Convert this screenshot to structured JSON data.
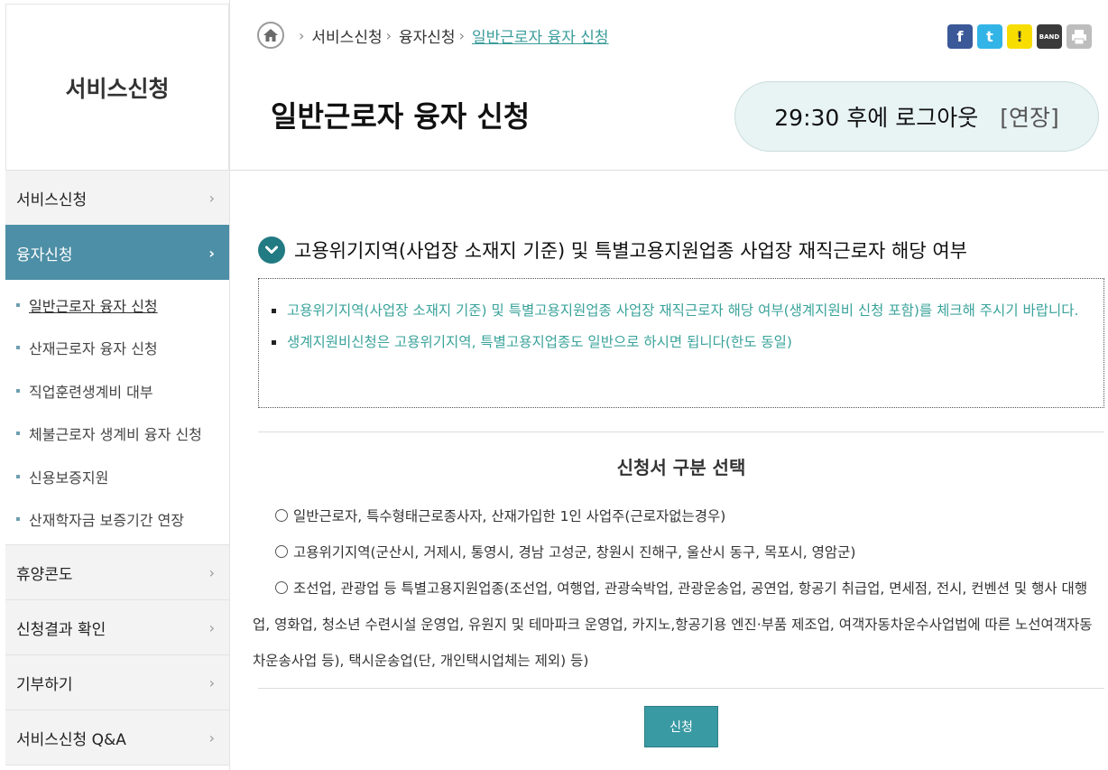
{
  "sidebar": {
    "title": "서비스신청",
    "items": [
      {
        "label": "서비스신청",
        "chevron": "›"
      },
      {
        "label": "융자신청",
        "chevron": "›"
      },
      {
        "label": "휴양콘도",
        "chevron": "›"
      },
      {
        "label": "신청결과 확인",
        "chevron": "›"
      },
      {
        "label": "기부하기",
        "chevron": "›"
      },
      {
        "label": "서비스신청 Q&A",
        "chevron": "›"
      }
    ],
    "sub_items": [
      {
        "label": "일반근로자 융자 신청"
      },
      {
        "label": "산재근로자 융자 신청"
      },
      {
        "label": "직업훈련생계비 대부"
      },
      {
        "label": "체불근로자 생계비 융자 신청"
      },
      {
        "label": "신용보증지원"
      },
      {
        "label": "산재학자금 보증기간 연장"
      }
    ]
  },
  "header": {
    "breadcrumb": [
      {
        "label": "서비스신청"
      },
      {
        "label": "융자신청"
      },
      {
        "label": "일반근로자 융자 신청"
      }
    ],
    "separator": "›",
    "title": "일반근로자 융자 신청",
    "logout_timer": "29:30 후에 로그아웃",
    "extend_label": "[연장]",
    "social_icons": [
      "facebook-icon",
      "twitter-icon",
      "kakaostory-icon",
      "band-icon",
      "print-icon"
    ],
    "social": {
      "fb": "f",
      "tw": "t",
      "ks": "!",
      "band": "BAND"
    }
  },
  "main": {
    "section_heading": "고용위기지역(사업장 소재지 기준) 및 특별고용지원업종 사업장 재직근로자 해당 여부",
    "notices": [
      {
        "text": "고용위기지역(사업장 소재지 기준) 및 특별고용지원업종 사업장 재직근로자 해당 여부(생계지원비 신청 포함)를 체크해 주시기 바랍니다."
      },
      {
        "text": "생계지원비신청은 고용위기지역, 특별고용지업종도 일반으로 하시면 됩니다(한도 동일)"
      }
    ],
    "select_title": "신청서 구분 선택",
    "options": [
      {
        "label": "일반근로자, 특수형태근로종사자, 산재가입한 1인 사업주(근로자없는경우)"
      },
      {
        "label": "고용위기지역(군산시, 거제시, 통영시, 경남 고성군, 창원시 진해구, 울산시 동구, 목포시, 영암군)"
      },
      {
        "label": "조선업, 관광업 등 특별고용지원업종(조선업, 여행업, 관광숙박업, 관광운송업, 공연업, 항공기 취급업, 면세점, 전시, 컨벤션 및 행사 대행업, 영화업, 청소년 수련시설 운영업, 유원지 및 테마파크 운영업, 카지노,항공기용 엔진·부품 제조업, 여객자동차운수사업법에 따른 노선여객자동차운송사업 등), 택시운송업(단, 개인택시업체는 제외) 등)"
      }
    ],
    "submit_label": "신청"
  },
  "colors": {
    "accent": "#4d8fa6",
    "teal_text": "#3aa39b",
    "heading_icon": "#227a82",
    "button": "#3a9aa3"
  }
}
